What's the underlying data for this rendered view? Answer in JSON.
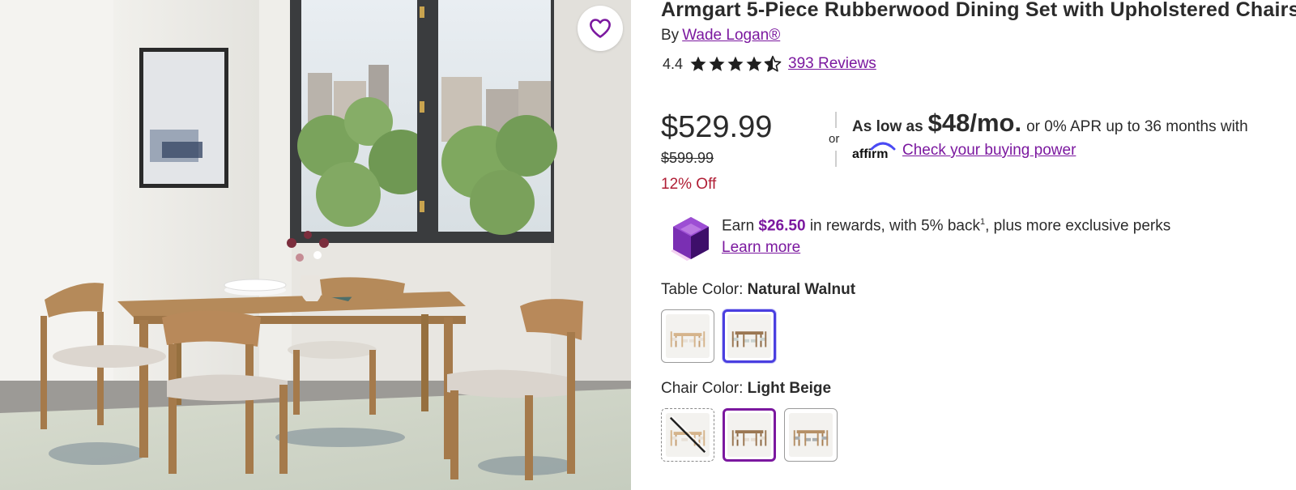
{
  "product": {
    "title": "Armgart 5-Piece Rubberwood Dining Set with Upholstered Chairs",
    "by_prefix": "By",
    "brand": "Wade Logan®",
    "rating": "4.4",
    "rating_value": 4.4,
    "rating_max": 5,
    "reviews": "393 Reviews"
  },
  "pricing": {
    "price": "$529.99",
    "original_price": "$599.99",
    "discount": "12% Off",
    "or_label": "or"
  },
  "financing": {
    "as_low_as": "As low as",
    "monthly": "$48/mo.",
    "terms": "or 0% APR up to 36 months with",
    "link": "Check your buying power",
    "provider": "affirm"
  },
  "rewards": {
    "earn": "Earn",
    "amount": "$26.50",
    "rest": "in rewards, with 5% back",
    "footnote": "1",
    "tail": ", plus more exclusive perks",
    "learn_more": "Learn more"
  },
  "table_color": {
    "label": "Table Color:",
    "value": "Natural Walnut",
    "options": [
      {
        "name": "natural-light",
        "selected": false
      },
      {
        "name": "natural-walnut",
        "selected": true
      }
    ]
  },
  "chair_color": {
    "label": "Chair Color:",
    "value": "Light Beige",
    "options": [
      {
        "name": "unavailable",
        "selected": false,
        "unavailable": true
      },
      {
        "name": "light-beige",
        "selected": true
      },
      {
        "name": "grey",
        "selected": false
      }
    ]
  },
  "icons": {
    "favorite": "heart-icon",
    "star": "star-icon",
    "rewards": "gem-icon"
  },
  "colors": {
    "accent": "#7b189f",
    "discount": "#b01e35",
    "swatch_selected": "#4a3fe0"
  }
}
